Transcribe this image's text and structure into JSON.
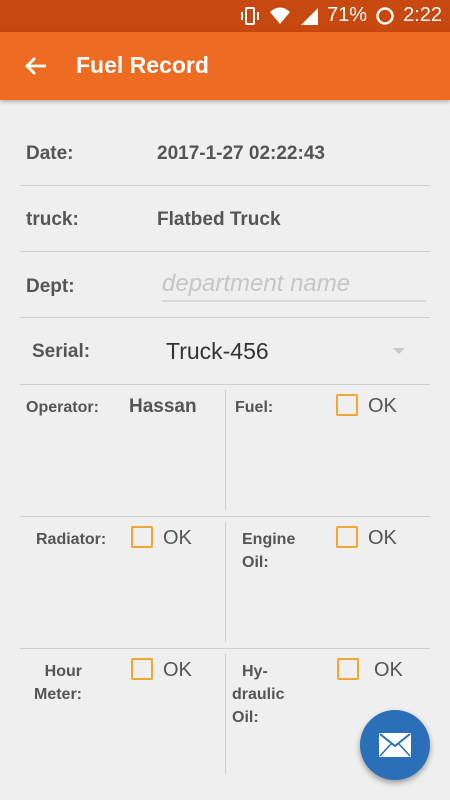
{
  "statusbar": {
    "battery": "71%",
    "time": "2:22"
  },
  "appbar": {
    "title": "Fuel Record"
  },
  "rows": {
    "date": {
      "label": "Date:",
      "value": "2017-1-27 02:22:43"
    },
    "truck": {
      "label": "truck:",
      "value": "Flatbed Truck"
    },
    "dept": {
      "label": "Dept:",
      "placeholder": "department name"
    },
    "serial": {
      "label": "Serial:",
      "value": "Truck-456"
    }
  },
  "grid": {
    "operator": {
      "label": "Operator:",
      "value": "Hassan"
    },
    "fuel": {
      "label": "Fuel:",
      "check": "OK"
    },
    "radiator": {
      "label": "Radiator:",
      "check": "OK"
    },
    "engine_oil": {
      "label1": "Engine",
      "label2": "Oil:",
      "check": "OK"
    },
    "hour_meter": {
      "label1": "Hour",
      "label2": "Meter:",
      "check": "OK"
    },
    "hydraulic_oil": {
      "label1": "Hy-",
      "label2": "draulic",
      "label3": "Oil:",
      "check": "OK"
    }
  },
  "colors": {
    "appbar": "#ee6b22",
    "statusbar": "#c8490f",
    "checkbox": "#f0a830",
    "fab": "#2a6fb8"
  }
}
